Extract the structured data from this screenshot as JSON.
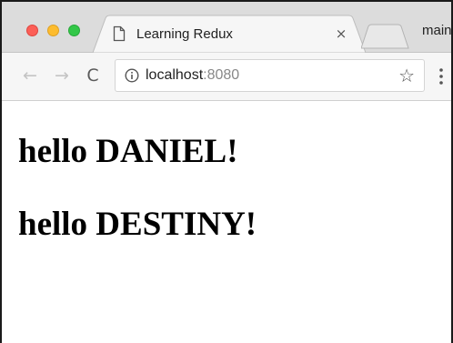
{
  "browser": {
    "tab": {
      "title": "Learning Redux",
      "close_label": "×"
    },
    "profile_label": "main",
    "toolbar": {
      "back_label": "←",
      "forward_label": "→",
      "reload_label": "C",
      "url_host": "localhost",
      "url_port": ":8080",
      "bookmark_label": "☆"
    }
  },
  "page": {
    "greetings": [
      "hello DANIEL!",
      "hello DESTINY!"
    ]
  },
  "colors": {
    "traffic_close": "#fc5f57",
    "traffic_minimize": "#fdbc2e",
    "traffic_maximize": "#33c748",
    "tabstrip_bg": "#dcdcdc",
    "toolbar_bg": "#f6f6f6"
  },
  "icons": {
    "tab_favicon": "page-icon",
    "info": "info-icon",
    "bookmark": "star-icon",
    "menu": "kebab-menu-icon"
  }
}
